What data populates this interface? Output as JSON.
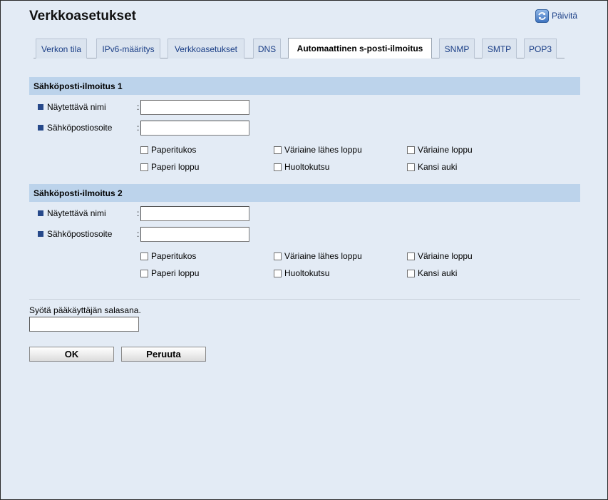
{
  "page": {
    "title": "Verkkoasetukset",
    "refresh_label": "Päivitä"
  },
  "tabs": [
    {
      "label": "Verkon tila",
      "active": false
    },
    {
      "label": "IPv6-määritys",
      "active": false
    },
    {
      "label": "Verkkoasetukset",
      "active": false
    },
    {
      "label": "DNS",
      "active": false
    },
    {
      "label": "Automaattinen s-posti-ilmoitus",
      "active": true
    },
    {
      "label": "SNMP",
      "active": false
    },
    {
      "label": "SMTP",
      "active": false
    },
    {
      "label": "POP3",
      "active": false
    }
  ],
  "sections": [
    {
      "header": "Sähköposti-ilmoitus 1",
      "display_name_label": "Näytettävä nimi",
      "display_name_value": "",
      "email_label": "Sähköpostiosoite",
      "email_value": "",
      "separator": ":",
      "checkboxes": [
        {
          "label": "Paperitukos",
          "checked": false
        },
        {
          "label": "Väriaine lähes loppu",
          "checked": false
        },
        {
          "label": "Väriaine loppu",
          "checked": false
        },
        {
          "label": "Paperi loppu",
          "checked": false
        },
        {
          "label": "Huoltokutsu",
          "checked": false
        },
        {
          "label": "Kansi auki",
          "checked": false
        }
      ]
    },
    {
      "header": "Sähköposti-ilmoitus 2",
      "display_name_label": "Näytettävä nimi",
      "display_name_value": "",
      "email_label": "Sähköpostiosoite",
      "email_value": "",
      "separator": ":",
      "checkboxes": [
        {
          "label": "Paperitukos",
          "checked": false
        },
        {
          "label": "Väriaine lähes loppu",
          "checked": false
        },
        {
          "label": "Väriaine loppu",
          "checked": false
        },
        {
          "label": "Paperi loppu",
          "checked": false
        },
        {
          "label": "Huoltokutsu",
          "checked": false
        },
        {
          "label": "Kansi auki",
          "checked": false
        }
      ]
    }
  ],
  "password": {
    "label": "Syötä pääkäyttäjän salasana.",
    "value": ""
  },
  "buttons": {
    "ok_label": "OK",
    "cancel_label": "Peruuta"
  },
  "colors": {
    "background": "#e3ebf5",
    "section_header": "#bcd3eb",
    "tab_text": "#1b3f87",
    "bullet": "#27498a"
  },
  "icons": {
    "refresh": "refresh-icon",
    "bullet": "square-bullet-icon"
  }
}
